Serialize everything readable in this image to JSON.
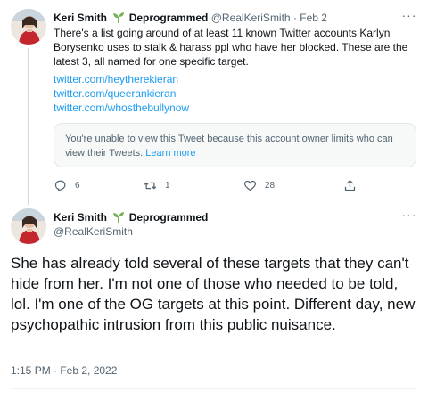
{
  "tweet1": {
    "author_name": "Keri Smith",
    "author_suffix": "Deprogrammed",
    "handle": "@RealKeriSmith",
    "separator": "·",
    "date": "Feb 2",
    "more_label": "···",
    "text": "There's a list going around of at least 11 known Twitter accounts Karlyn Borysenko uses to stalk & harass ppl who have her blocked. These are the latest 3, all named for one specific target.",
    "links": [
      "twitter.com/heytherekieran",
      "twitter.com/queerankieran",
      "twitter.com/whosthebullynow"
    ],
    "unavailable_notice": "You're unable to view this Tweet because this account owner limits who can view their Tweets.",
    "learn_more": "Learn more",
    "replies": "6",
    "retweets": "1",
    "likes": "28"
  },
  "tweet2": {
    "author_name": "Keri Smith",
    "author_suffix": "Deprogrammed",
    "handle": "@RealKeriSmith",
    "more_label": "···",
    "text": "She has already told several of these targets that they can't hide from her. I'm not one of those who needed to be told, lol. I'm one of the OG targets at this point. Different day, new psychopathic intrusion from this public nuisance.",
    "timestamp": "1:15 PM · Feb 2, 2022"
  },
  "icons": {
    "verified_sprout": "sprout-emoji-icon",
    "reply": "reply-icon",
    "retweet": "retweet-icon",
    "like": "heart-icon",
    "share": "share-icon",
    "more": "more-options-icon"
  },
  "colors": {
    "link": "#1d9bf0",
    "secondary_text": "#536471",
    "primary_text": "#0f1419",
    "sprout_green": "#5aa02c"
  }
}
